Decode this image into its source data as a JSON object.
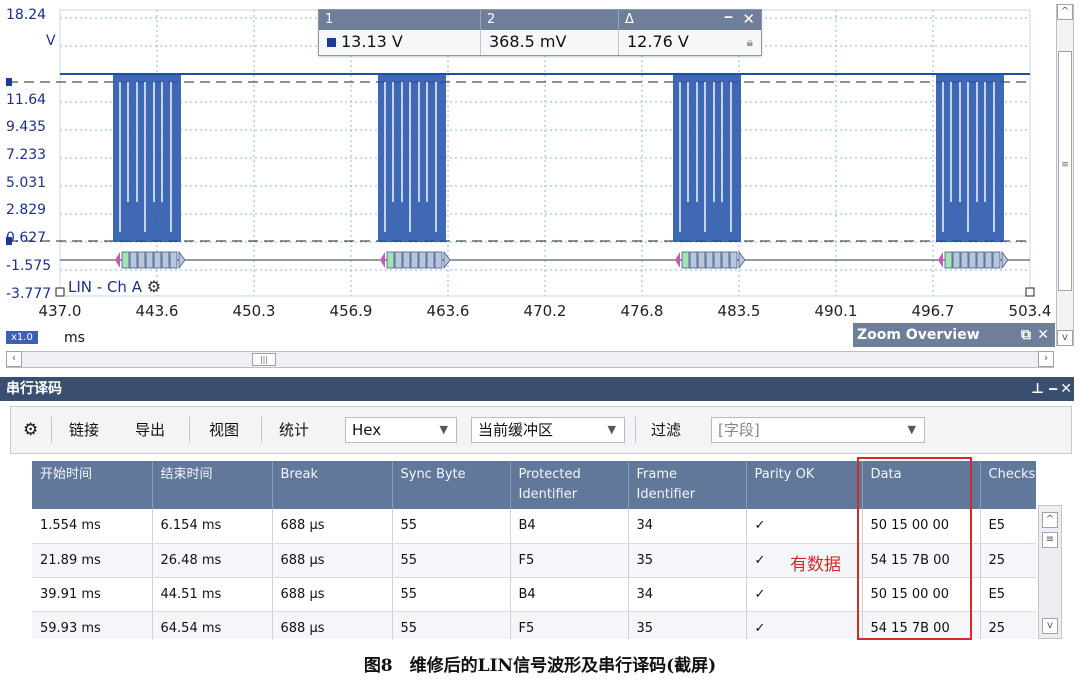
{
  "chart": {
    "y_labels": [
      "18.24",
      "V",
      "11.64",
      "9.435",
      "7.233",
      "5.031",
      "2.829",
      "0.627",
      "-1.575",
      "-3.777"
    ],
    "x_labels": [
      "437.0",
      "443.6",
      "450.3",
      "456.9",
      "463.6",
      "470.2",
      "476.8",
      "483.5",
      "490.1",
      "496.7",
      "503.4"
    ],
    "channel_label": "LIN - Ch A",
    "unit": "ms",
    "zoom_badge": "x1.0",
    "line_color": "#1f4fa8"
  },
  "measure": {
    "headers": [
      "1",
      "2",
      "Δ"
    ],
    "values": [
      "13.13 V",
      "368.5 mV",
      "12.76 V"
    ],
    "close_icon": "close-icon"
  },
  "zoom_overview": {
    "title": "Zoom Overview"
  },
  "decoder": {
    "panel_title": "串行译码",
    "toolbar": {
      "link": "链接",
      "export": "导出",
      "view": "视图",
      "stats": "统计",
      "format": "Hex",
      "buffer": "当前缓冲区",
      "filter": "过滤",
      "field_placeholder": "[字段]"
    },
    "table": {
      "headers": [
        "开始时间",
        "结束时间",
        "Break",
        "Sync Byte",
        "Protected Identifier",
        "Frame Identifier",
        "Parity OK",
        "Data",
        "Checksu"
      ],
      "rows": [
        [
          "1.554 ms",
          "6.154 ms",
          "688 μs",
          "55",
          "B4",
          "34",
          "✓",
          "50 15 00 00",
          "E5"
        ],
        [
          "21.89 ms",
          "26.48 ms",
          "688 μs",
          "55",
          "F5",
          "35",
          "✓",
          "54 15 7B 00",
          "25"
        ],
        [
          "39.91 ms",
          "44.51 ms",
          "688 μs",
          "55",
          "B4",
          "34",
          "✓",
          "50 15 00 00",
          "E5"
        ],
        [
          "59.93 ms",
          "64.54 ms",
          "688 μs",
          "55",
          "F5",
          "35",
          "✓",
          "54 15 7B 00",
          "25"
        ]
      ]
    }
  },
  "annotation": {
    "note": "有数据",
    "highlight_color": "#d42a2a"
  },
  "caption": "图8　维修后的LIN信号波形及串行译码(截屏)"
}
